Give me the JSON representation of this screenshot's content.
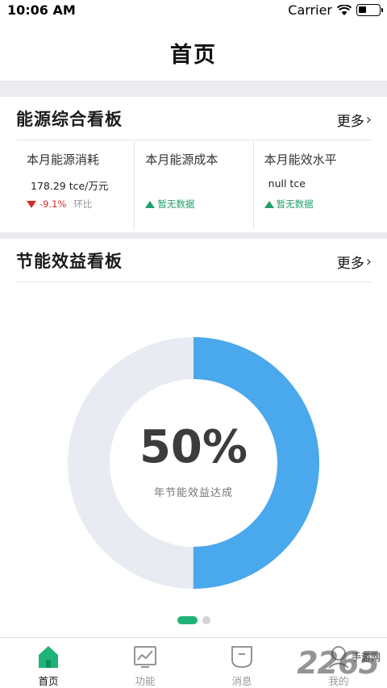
{
  "status_bar": {
    "time": "10:06 AM",
    "carrier": "Carrier"
  },
  "nav": {
    "title": "首页"
  },
  "energy_board": {
    "title": "能源综合看板",
    "more_label": "更多",
    "kpis": [
      {
        "label": "本月能源消耗",
        "value": "178.29  tce/万元",
        "trend_text": "-9.1%",
        "trend_sub": "环比",
        "trend_dir": "down"
      },
      {
        "label": "本月能源成本",
        "value": "",
        "trend_text": "暂无数据",
        "trend_sub": "",
        "trend_dir": "up"
      },
      {
        "label": "本月能效水平",
        "value": "null  tce",
        "trend_text": "暂无数据",
        "trend_sub": "",
        "trend_dir": "up"
      }
    ]
  },
  "saving_board": {
    "title": "节能效益看板",
    "more_label": "更多",
    "donut": {
      "percent_text": "50%",
      "progress": 0.5,
      "label": "年节能效益达成",
      "fill_color": "#4aa8ec",
      "track_color": "#e8ebf1"
    }
  },
  "pager": {
    "active": 0,
    "count": 2
  },
  "tabs": [
    {
      "label": "首页",
      "icon": "home-icon",
      "active": true
    },
    {
      "label": "功能",
      "icon": "chart-icon",
      "active": false
    },
    {
      "label": "消息",
      "icon": "message-icon",
      "active": false
    },
    {
      "label": "我的",
      "icon": "profile-icon",
      "active": false
    }
  ],
  "watermark": {
    "main": "2265",
    "sub": "手游网"
  },
  "colors": {
    "accent": "#1fb37a",
    "down": "#d62a2a",
    "up": "#22a06b"
  }
}
